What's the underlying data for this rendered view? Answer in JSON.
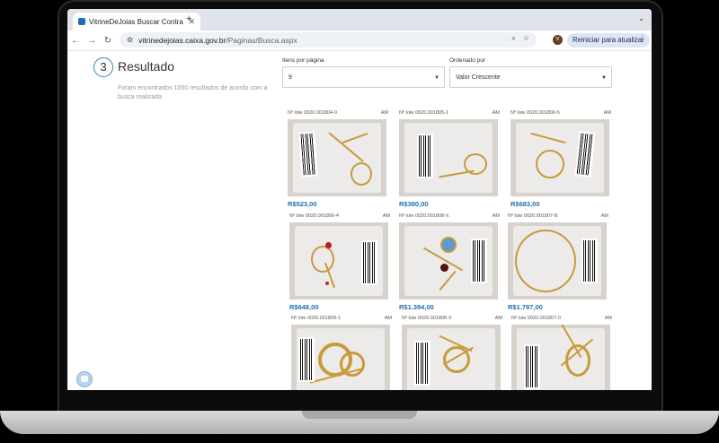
{
  "browser": {
    "tab_title": "VitrineDeJoias Buscar Contra",
    "url_host": "vitrinedejoias.caixa.gov.br",
    "url_path": "/Paginas/Busca.aspx",
    "reload_button": "Reiniciar para atualizar",
    "avatar_letter": "V"
  },
  "page": {
    "step_number": "3",
    "section_title": "Resultado",
    "results_text": "Foram encontrados 1050 resultados de acordo com a busca realizada",
    "items_per_page_label": "Itens por página",
    "items_per_page_value": "9",
    "sort_label": "Ordenado por",
    "sort_value": "Valor Crescente"
  },
  "products": [
    {
      "lot": "Nº lote 0020.001804-0",
      "state": "AM",
      "price": "R$523,00"
    },
    {
      "lot": "Nº lote 0020.001805-1",
      "state": "AM",
      "price": "R$380,00"
    },
    {
      "lot": "Nº lote 0020.001800-5",
      "state": "AM",
      "price": "R$683,00"
    },
    {
      "lot": "Nº lote 0020.001806-4",
      "state": "AM",
      "price": "R$648,00"
    },
    {
      "lot": "Nº lote 0020.001808-X",
      "state": "AM",
      "price": "R$1.394,00"
    },
    {
      "lot": "Nº lote 0020.001807-B",
      "state": "AM",
      "price": "R$1.797,00"
    },
    {
      "lot": "Nº lote 0020.001809-1",
      "state": "AM",
      "price": ""
    },
    {
      "lot": "Nº lote 0020.001808-X",
      "state": "AM",
      "price": ""
    },
    {
      "lot": "Nº lote 0020.001807-0",
      "state": "AM",
      "price": ""
    }
  ],
  "colors": {
    "accent": "#1f6fb4",
    "step_ring": "#2c88b8"
  }
}
